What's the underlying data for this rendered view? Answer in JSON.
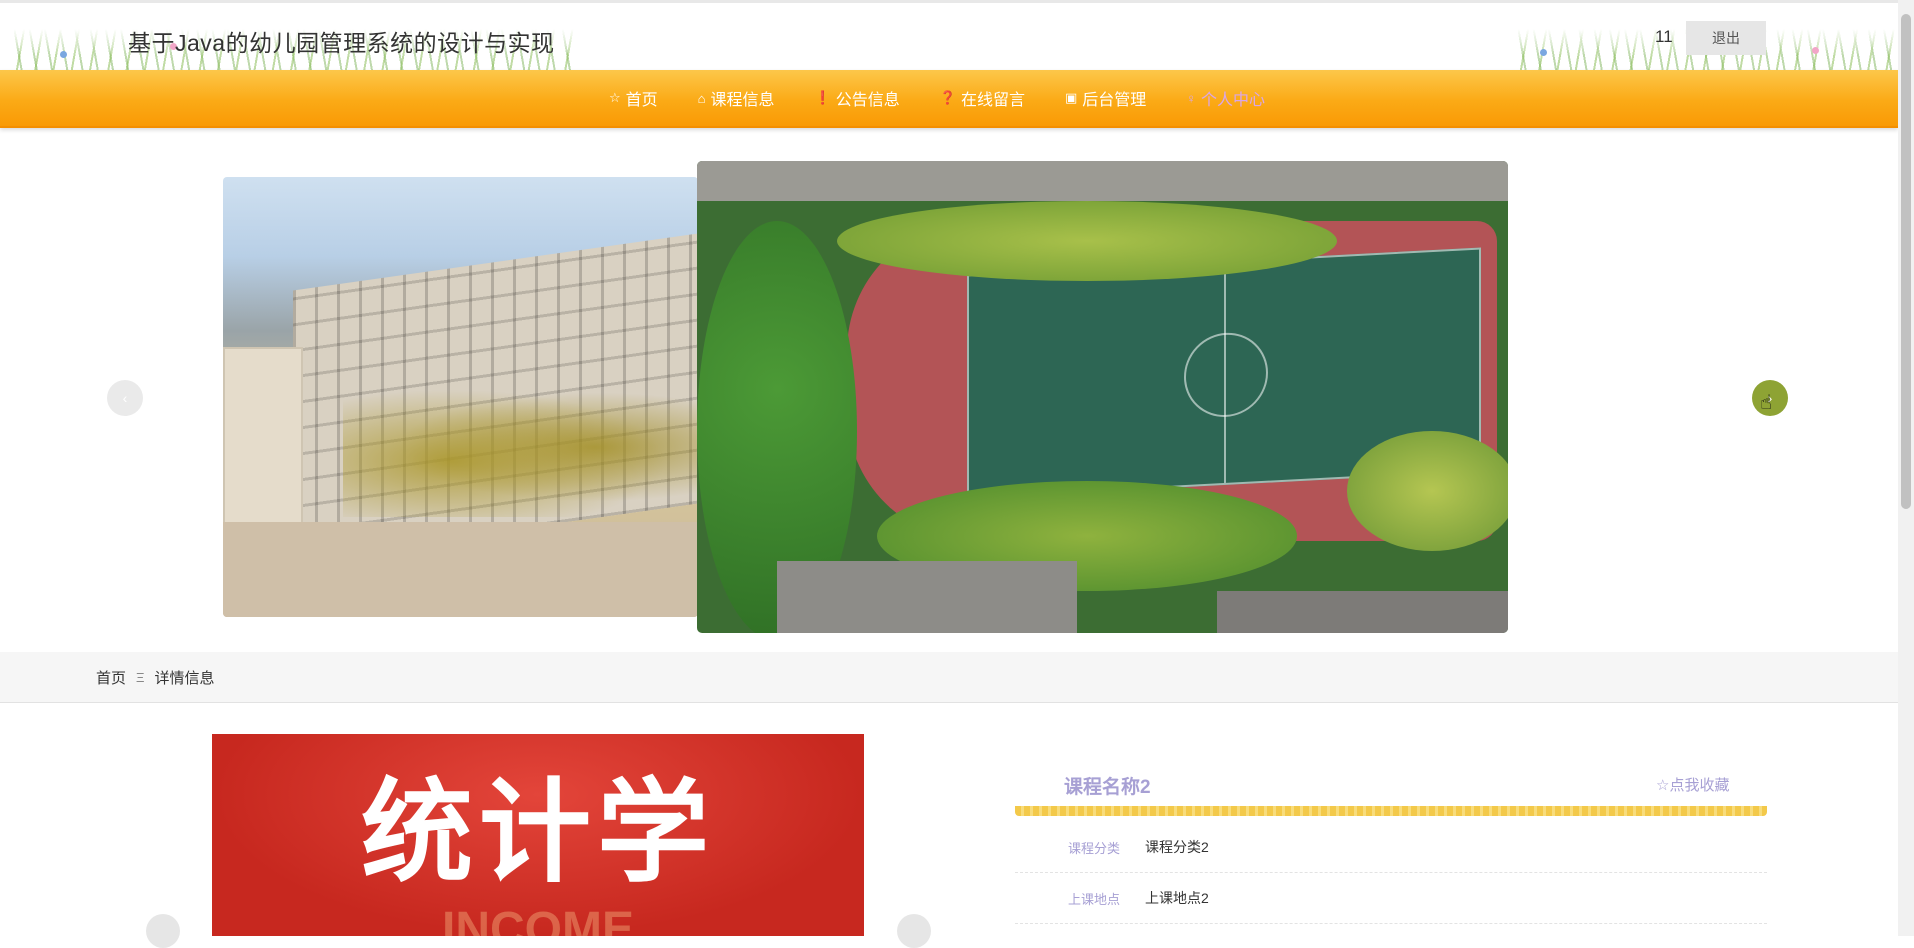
{
  "header": {
    "site_title": "基于Java的幼儿园管理系统的设计与实现",
    "username": "11",
    "logout_label": "退出"
  },
  "nav": {
    "items": [
      {
        "label": "首页",
        "icon": "star-icon",
        "glyph": "☆"
      },
      {
        "label": "课程信息",
        "icon": "bag-icon",
        "glyph": "⌂"
      },
      {
        "label": "公告信息",
        "icon": "info-icon",
        "glyph": "❗"
      },
      {
        "label": "在线留言",
        "icon": "question-icon",
        "glyph": "❓"
      },
      {
        "label": "后台管理",
        "icon": "briefcase-icon",
        "glyph": "▣"
      },
      {
        "label": "个人中心",
        "icon": "user-icon",
        "glyph": "♀",
        "active": true
      }
    ]
  },
  "carousel": {
    "slides": [
      "campus-building",
      "aerial-sports-field"
    ],
    "active_index": 1
  },
  "breadcrumb": {
    "home": "首页",
    "separator": "Ξ",
    "current": "详情信息"
  },
  "detail": {
    "image_text": "统计学",
    "image_subtext": "INCOME",
    "course_name": "课程名称2",
    "favorite_label": "☆点我收藏",
    "fields": [
      {
        "label": "课程分类",
        "value": "课程分类2"
      },
      {
        "label": "上课地点",
        "value": "上课地点2"
      }
    ]
  },
  "colors": {
    "nav_orange": "#fbaa16",
    "accent_purple": "#a7a0d4",
    "gold_rule": "#f3c94a",
    "arrow_active": "#8ea334"
  }
}
